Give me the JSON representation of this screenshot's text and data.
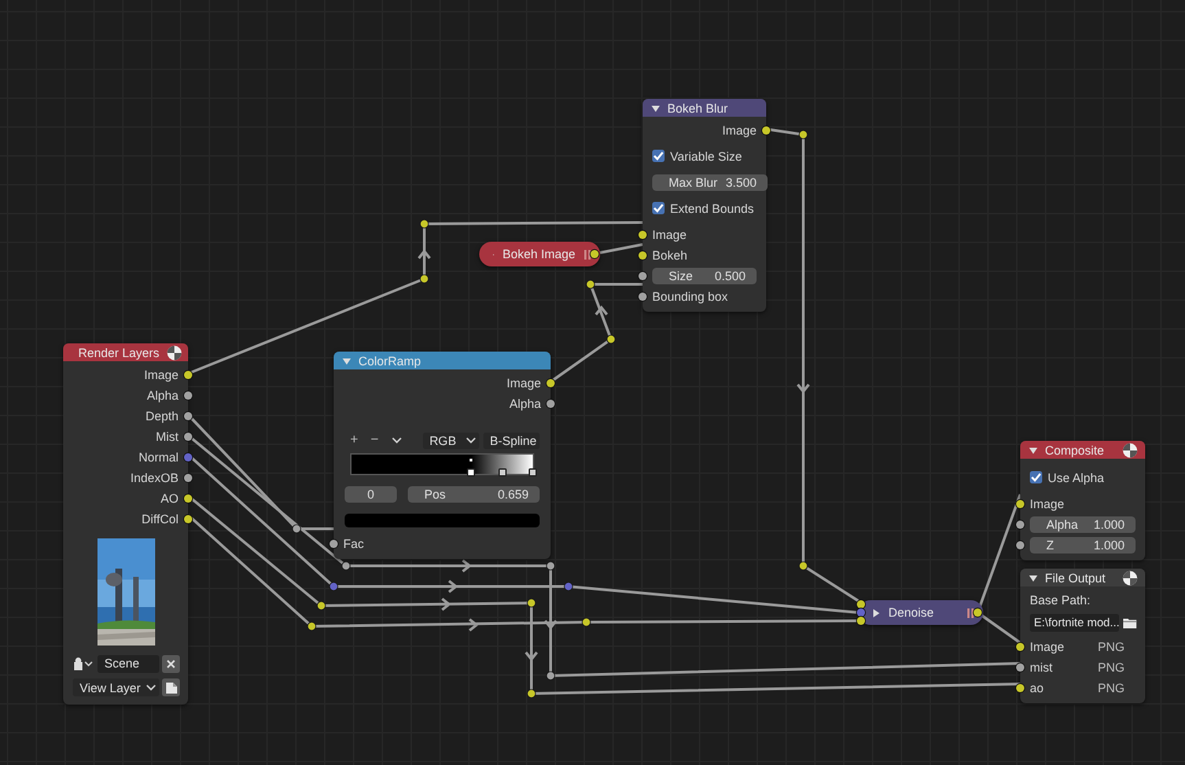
{
  "nodes": [
    {
      "title": "Bokeh Blur",
      "color": "#4f4878",
      "collapsed": false,
      "preview_icon": false,
      "rows": [
        {
          "kind": "output",
          "label": "Image",
          "color": "#c7c729"
        },
        {
          "kind": "checkbox",
          "label": "Variable Size",
          "checked": true
        },
        {
          "kind": "field",
          "label": "Max Blur",
          "value": "3.500"
        },
        {
          "kind": "checkbox",
          "label": "Extend Bounds",
          "checked": true
        },
        {
          "kind": "input",
          "label": "Image",
          "color": "#c7c729"
        },
        {
          "kind": "input",
          "label": "Bokeh",
          "color": "#c7c729"
        },
        {
          "kind": "field",
          "label": "Size",
          "value": "0.500",
          "color": "#a1a1a1"
        },
        {
          "kind": "input",
          "label": "Bounding box",
          "color": "#a1a1a1"
        }
      ]
    },
    {
      "title": "Bokeh Image",
      "color": "#a8343f",
      "collapsed": true,
      "outputs": [
        {
          "color": "#c7c729"
        }
      ]
    },
    {
      "title": "Render Layers",
      "color": "#a8343f",
      "collapsed": false,
      "preview_icon": true,
      "rows": [
        {
          "kind": "output",
          "label": "Image",
          "color": "#c7c729"
        },
        {
          "kind": "output",
          "label": "Alpha",
          "color": "#a1a1a1"
        },
        {
          "kind": "output",
          "label": "Depth",
          "color": "#a1a1a1"
        },
        {
          "kind": "output",
          "label": "Mist",
          "color": "#a1a1a1"
        },
        {
          "kind": "output",
          "label": "Normal",
          "color": "#6363c7"
        },
        {
          "kind": "output",
          "label": "IndexOB",
          "color": "#a1a1a1"
        },
        {
          "kind": "output",
          "label": "AO",
          "color": "#c7c729"
        },
        {
          "kind": "output",
          "label": "DiffCol",
          "color": "#c7c729"
        },
        {
          "kind": "picture"
        },
        {
          "kind": "scene",
          "value": "Scene"
        },
        {
          "kind": "view_layer",
          "value": "View Layer"
        }
      ]
    },
    {
      "title": "ColorRamp",
      "color": "#3c87b7",
      "collapsed": false,
      "preview_icon": false,
      "rows": [
        {
          "kind": "output",
          "label": "Image",
          "color": "#c7c729"
        },
        {
          "kind": "output",
          "label": "Alpha",
          "color": "#a1a1a1"
        },
        {
          "kind": "ramp_toolbar",
          "buttons": [
            "+",
            "−"
          ],
          "mode": "RGB",
          "interpolation": "B-Spline"
        },
        {
          "kind": "ramp",
          "stops": [
            {
              "level": 0.659,
              "selected": true
            },
            {
              "level": 0.83,
              "selected": false
            },
            {
              "level": 1,
              "selected": false
            }
          ]
        },
        {
          "kind": "ramp_fields",
          "index": "0",
          "label": "Pos",
          "value": "0.659"
        },
        {
          "kind": "swatch",
          "color": "#000000"
        },
        {
          "kind": "input",
          "label": "Fac",
          "color": "#a1a1a1"
        }
      ]
    },
    {
      "title": "Composite",
      "color": "#a8343f",
      "collapsed": false,
      "preview_icon": true,
      "rows": [
        {
          "kind": "checkbox",
          "label": "Use Alpha",
          "checked": true
        },
        {
          "kind": "input",
          "label": "Image",
          "color": "#c7c729"
        },
        {
          "kind": "field",
          "label": "Alpha",
          "value": "1.000",
          "color": "#a1a1a1"
        },
        {
          "kind": "field",
          "label": "Z",
          "value": "1.000",
          "color": "#a1a1a1"
        }
      ]
    },
    {
      "title": "File Output",
      "color": "#3d3d3d",
      "collapsed": false,
      "preview_icon": true,
      "rows": [
        {
          "kind": "label",
          "label": "Base Path:"
        },
        {
          "kind": "path",
          "value": "E:\\fortnite mod..."
        },
        {
          "kind": "input",
          "label": "Image",
          "color": "#c7c729",
          "format": "PNG"
        },
        {
          "kind": "input",
          "label": "mist",
          "color": "#a1a1a1",
          "format": "PNG"
        },
        {
          "kind": "input",
          "label": "ao",
          "color": "#c7c729",
          "format": "PNG"
        }
      ]
    },
    {
      "title": "Denoise",
      "color": "#4f4878",
      "collapsed": true,
      "inputs": [
        {
          "color": "#c7c729"
        },
        {
          "color": "#6363c7"
        },
        {
          "color": "#c7c729"
        }
      ],
      "outputs": [
        {
          "color": "#c7c729"
        }
      ]
    }
  ]
}
